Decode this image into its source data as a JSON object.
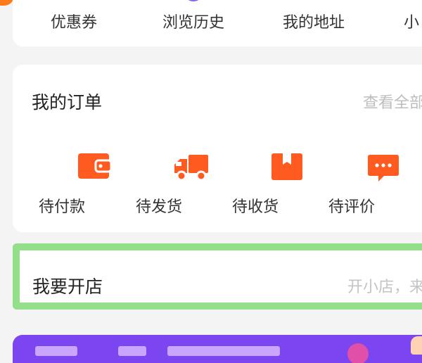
{
  "shortcuts": [
    {
      "label": "优惠券",
      "icon": "coupon-icon"
    },
    {
      "label": "浏览历史",
      "icon": "history-icon"
    },
    {
      "label": "我的地址",
      "icon": "address-icon"
    },
    {
      "label": "小",
      "icon": "shop-icon"
    }
  ],
  "orders": {
    "title": "我的订单",
    "view_all": "查看全部",
    "items": [
      {
        "label": "待付款",
        "icon": "wallet-icon"
      },
      {
        "label": "待发货",
        "icon": "truck-icon"
      },
      {
        "label": "待收货",
        "icon": "package-icon"
      },
      {
        "label": "待评价",
        "icon": "comment-icon"
      }
    ]
  },
  "shop": {
    "title": "我要开店",
    "subtitle": "开小店，来"
  },
  "colors": {
    "accent_orange": "#ff5a1f",
    "highlight_green": "#94df8a",
    "banner_purple": "#7b45f0"
  }
}
